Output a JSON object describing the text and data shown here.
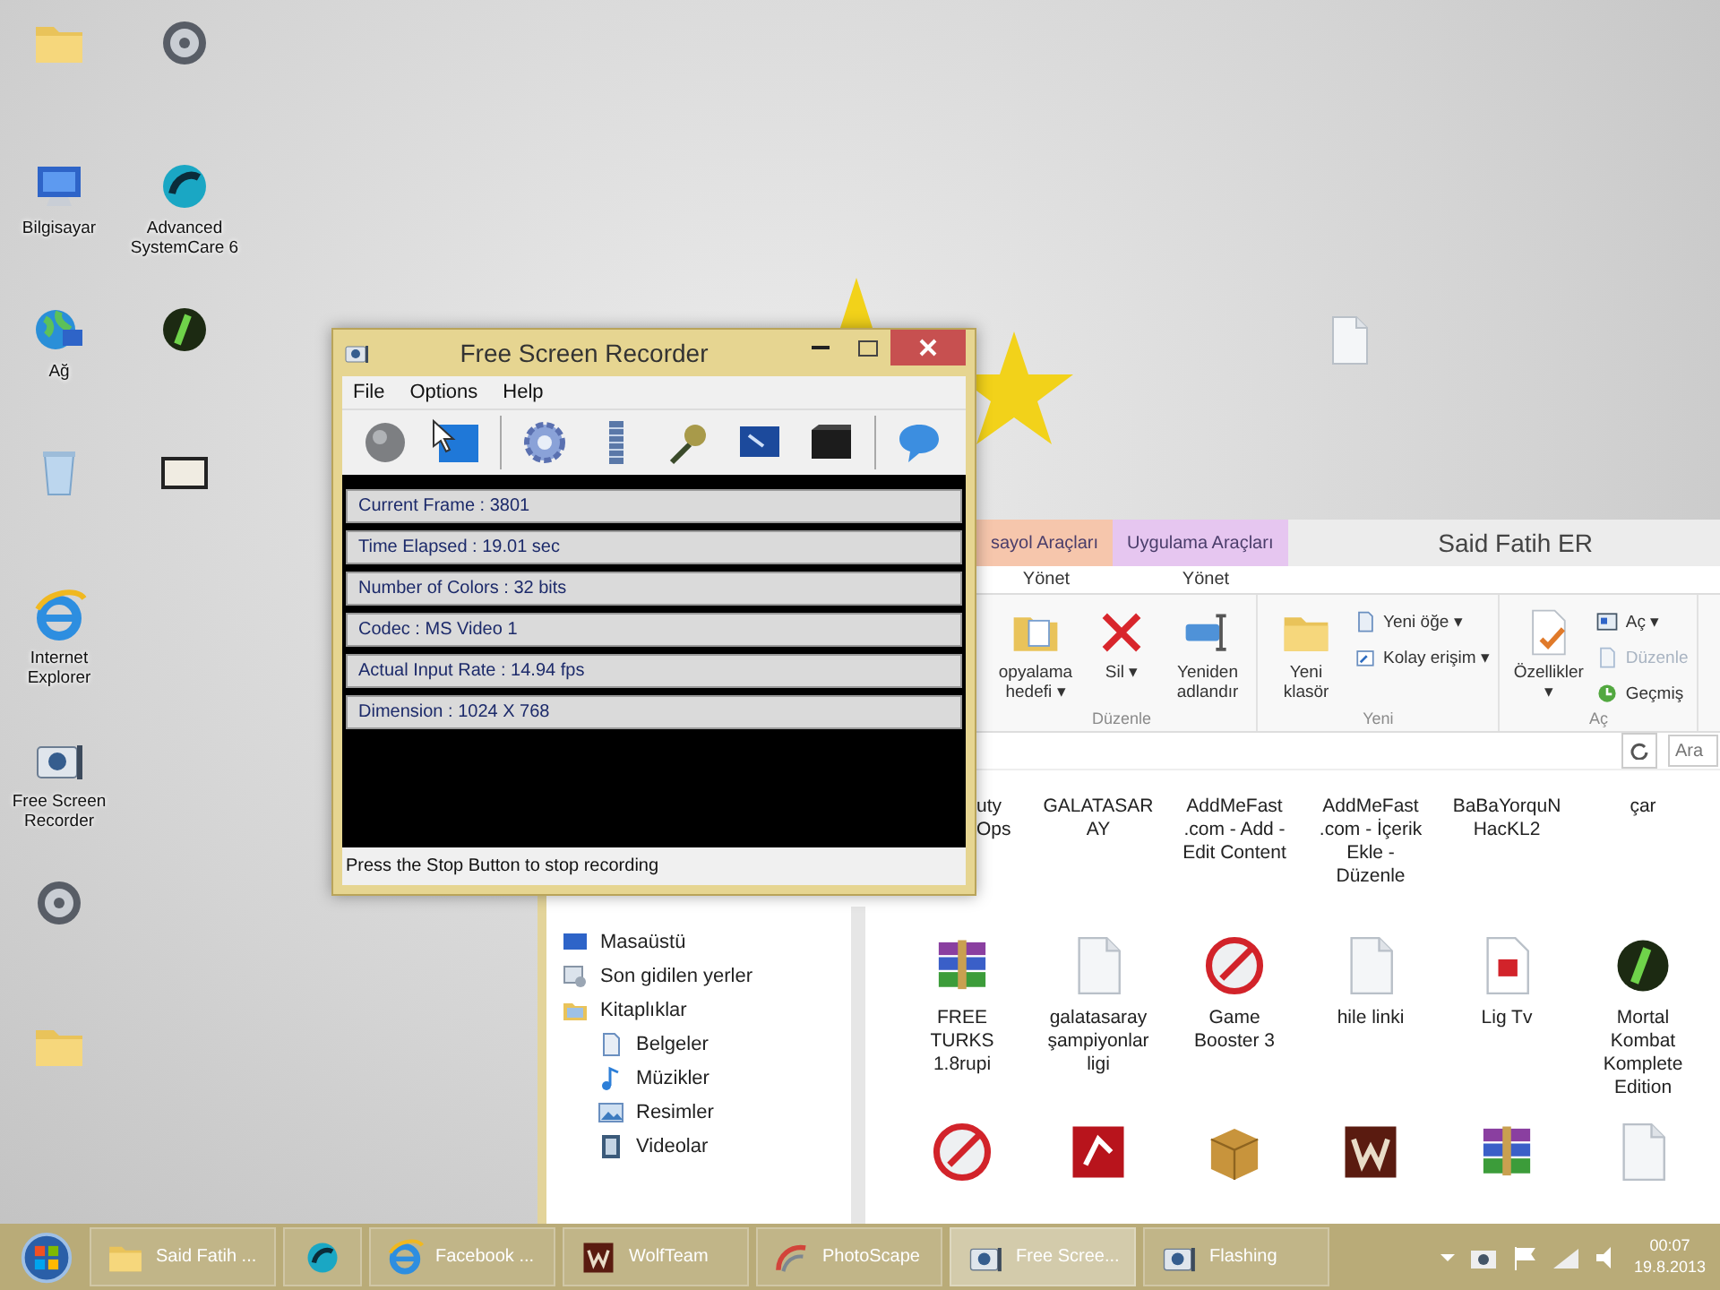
{
  "desktop": {
    "icons": [
      {
        "kind": "folder"
      },
      {
        "kind": "monitor",
        "label": "Bilgisayar"
      },
      {
        "kind": "globe",
        "label": "Ağ"
      },
      {
        "kind": "bin"
      },
      {
        "kind": "browser",
        "label": "Internet Explorer"
      },
      {
        "kind": "camera",
        "label": "Free Screen Recorder"
      },
      {
        "kind": "disc"
      },
      {
        "kind": "folder"
      },
      {
        "kind": "disc"
      },
      {
        "kind": "round",
        "label": "Advanced SystemCare 6"
      },
      {
        "kind": "round2"
      },
      {
        "kind": "frame"
      }
    ],
    "loose_icons": [
      {
        "kind": "doc"
      }
    ]
  },
  "recorder": {
    "title": "Free Screen Recorder",
    "menu": [
      "File",
      "Options",
      "Help"
    ],
    "toolbar": [
      {
        "kind": "record"
      },
      {
        "kind": "region"
      },
      {
        "kind": "separator"
      },
      {
        "kind": "gear"
      },
      {
        "kind": "film"
      },
      {
        "kind": "mic"
      },
      {
        "kind": "screen"
      },
      {
        "kind": "clapper"
      },
      {
        "kind": "separator"
      },
      {
        "kind": "chat"
      }
    ],
    "stats": [
      "Current Frame : 3801",
      "Time Elapsed : 19.01 sec",
      "Number of Colors : 32 bits",
      "Codec : MS Video 1",
      "Actual Input Rate : 14.94 fps",
      "Dimension : 1024 X 768"
    ],
    "status": "Press the Stop Button to stop recording"
  },
  "explorer": {
    "context_tabs": [
      {
        "label": "sayol Araçları",
        "color": "#f6c6ac",
        "tab": "Yönet"
      },
      {
        "label": "Uygulama Araçları",
        "color": "#e6c6f0",
        "tab": "Yönet"
      }
    ],
    "title": "Said Fatih ER",
    "ribbon_groups": [
      {
        "label": "Düzenle",
        "commands": [
          {
            "kind": "copy",
            "label": "opyalama hedefi ▾"
          },
          {
            "kind": "delete",
            "label": "Sil ▾"
          },
          {
            "kind": "rename",
            "label": "Yeniden adlandır"
          }
        ]
      },
      {
        "label": "Yeni",
        "commands": [
          {
            "kind": "newfolder",
            "label": "Yeni klasör"
          },
          {
            "kind": "newitem",
            "label": "Yeni öğe ▾",
            "disabled": false
          },
          {
            "kind": "easy",
            "label": "Kolay erişim ▾",
            "disabled": false
          }
        ]
      },
      {
        "label": "Aç",
        "commands": [
          {
            "kind": "props",
            "label": "Özellikler ▾"
          },
          {
            "kind": "open",
            "label": "Aç ▾",
            "disabled": false
          },
          {
            "kind": "edit",
            "label": "Düzenle",
            "disabled": true
          },
          {
            "kind": "history",
            "label": "Geçmiş",
            "disabled": false
          }
        ]
      }
    ],
    "search": {
      "placeholder": "Ara"
    },
    "nav": [
      {
        "kind": "desktop",
        "label": "Masaüstü"
      },
      {
        "kind": "recent",
        "label": "Son gidilen yerler"
      },
      {
        "kind": "library",
        "label": "Kitaplıklar",
        "children": [
          {
            "kind": "docs",
            "label": "Belgeler"
          },
          {
            "kind": "music",
            "label": "Müzikler"
          },
          {
            "kind": "pictures",
            "label": "Resimler"
          },
          {
            "kind": "videos",
            "label": "Videolar"
          }
        ]
      }
    ],
    "files": [
      {
        "kind": "none",
        "label": "uty Ops"
      },
      {
        "kind": "none",
        "label": "GALATASARAY"
      },
      {
        "kind": "none",
        "label": "AddMeFast .com - Add - Edit Content"
      },
      {
        "kind": "none",
        "label": "AddMeFast .com - İçerik Ekle - Düzenle"
      },
      {
        "kind": "none",
        "label": "BaBaYorquNHacKL2"
      },
      {
        "kind": "none",
        "label": "çar"
      },
      {
        "kind": "archive",
        "label": "FREE TURKS 1.8rupi"
      },
      {
        "kind": "doc",
        "label": "galatasaray şampiyonlar ligi"
      },
      {
        "kind": "gauge",
        "label": "Game Booster 3"
      },
      {
        "kind": "doc",
        "label": "hile linki"
      },
      {
        "kind": "pdf",
        "label": "Lig Tv"
      },
      {
        "kind": "round2",
        "label": "Mortal Kombat Komplete Edition"
      },
      {
        "kind": "gauge"
      },
      {
        "kind": "tile"
      },
      {
        "kind": "box"
      },
      {
        "kind": "tile2"
      },
      {
        "kind": "archive"
      },
      {
        "kind": "doc"
      }
    ]
  },
  "taskbar": {
    "items": [
      {
        "kind": "folder",
        "label": "Said Fatih ...",
        "selected": false
      },
      {
        "kind": "round",
        "selected": false
      },
      {
        "kind": "browser",
        "label": "Facebook ...",
        "selected": false
      },
      {
        "kind": "tile2",
        "label": "WolfTeam",
        "selected": false
      },
      {
        "kind": "arc",
        "label": "PhotoScape",
        "selected": false
      },
      {
        "kind": "camera",
        "label": "Free Scree...",
        "selected": true
      },
      {
        "kind": "camera",
        "label": "Flashing",
        "selected": false
      }
    ],
    "clock": {
      "time": "00:07",
      "date": "19.8.2013"
    }
  }
}
